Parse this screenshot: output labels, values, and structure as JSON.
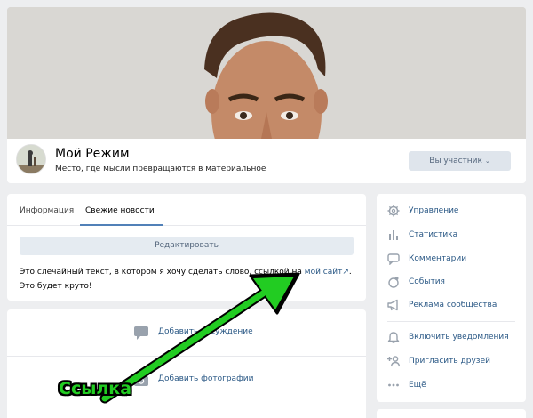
{
  "header": {
    "group_name": "Мой Режим",
    "group_description": "Место, где мысли превращаются в материальное",
    "member_button": "Вы участник",
    "member_chevron": "chevron-down-icon"
  },
  "tabs": [
    {
      "label": "Информация",
      "active": false
    },
    {
      "label": "Свежие новости",
      "active": true
    }
  ],
  "post": {
    "edit_button": "Редактировать",
    "text_before": "Это слечайный текст, в котором я хочу сделать слово, ссылкой на ",
    "link_text": "мой сайт",
    "text_after": ". Это будет круто!"
  },
  "actions": [
    {
      "label": "Добавить обсуждение",
      "icon": "comment-icon"
    },
    {
      "label": "Добавить фотографии",
      "icon": "camera-icon"
    }
  ],
  "sidebar": {
    "items": [
      {
        "label": "Управление",
        "icon": "gear-icon"
      },
      {
        "label": "Статистика",
        "icon": "stats-icon"
      },
      {
        "label": "Комментарии",
        "icon": "comment-icon"
      },
      {
        "label": "События",
        "icon": "event-icon"
      },
      {
        "label": "Реклама сообщества",
        "icon": "megaphone-icon"
      },
      {
        "label": "Включить уведомления",
        "icon": "bell-icon"
      },
      {
        "label": "Пригласить друзей",
        "icon": "add-user-icon"
      },
      {
        "label": "Ещё",
        "icon": "more-icon"
      }
    ]
  },
  "annotation": {
    "callout": "Ссылка"
  },
  "colors": {
    "link": "#2a5885",
    "accent": "#5181b8",
    "arrow": "#22cc22",
    "background": "#edeef0"
  }
}
